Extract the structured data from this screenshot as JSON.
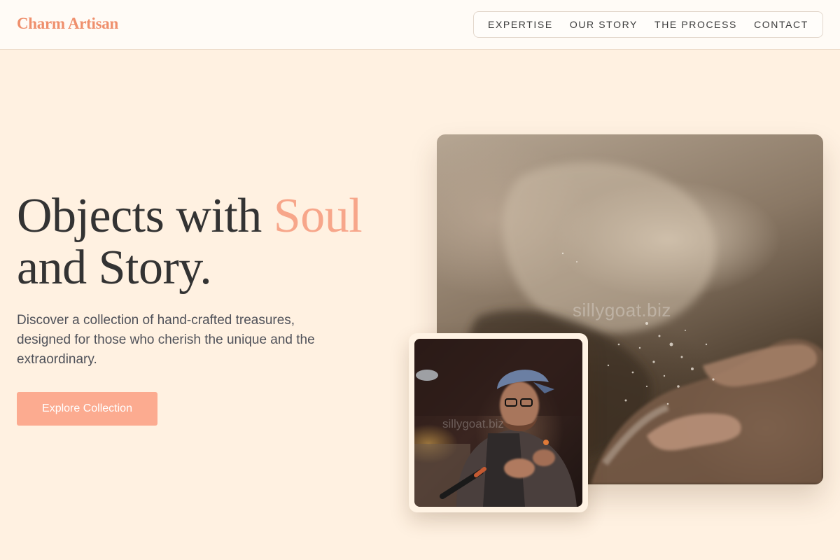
{
  "header": {
    "logo": "Charm Artisan",
    "nav": [
      {
        "label": "EXPERTISE"
      },
      {
        "label": "OUR STORY"
      },
      {
        "label": "THE PROCESS"
      },
      {
        "label": "CONTACT"
      }
    ]
  },
  "hero": {
    "headline_part1": "Objects with ",
    "headline_accent": "Soul",
    "headline_part2": "and Story.",
    "subtext": "Discover a collection of hand-crafted treasures, designed for those who cherish the unique and the extraordinary.",
    "cta_label": "Explore Collection"
  },
  "images": {
    "main_watermark": "sillygoat.biz",
    "inset_watermark": "sillygoat.biz"
  },
  "colors": {
    "background": "#fff1e1",
    "accent": "#f7a68a",
    "logo": "#ef8f6c",
    "button": "#fcab90"
  }
}
